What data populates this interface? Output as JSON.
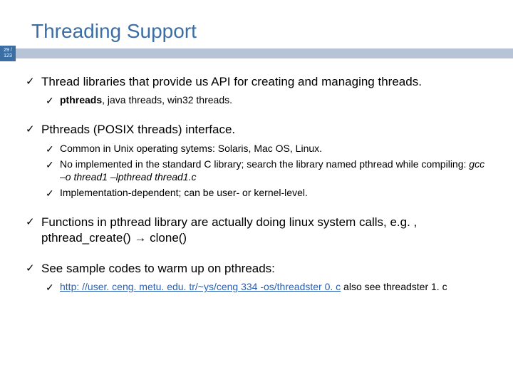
{
  "page": {
    "current": "29",
    "total": "123"
  },
  "title": "Threading Support",
  "b1": {
    "text": "Thread libraries that provide us API for creating and managing threads."
  },
  "b1a_bold": "pthreads",
  "b1a_rest": ", java threads, win32 threads.",
  "b2": {
    "text": "Pthreads (POSIX threads) interface."
  },
  "b2a": "Common in Unix operating sytems: Solaris, Mac OS, Linux.",
  "b2b_pre": "No implemented in the standard C library; search the library named pthread while compiling: ",
  "b2b_italic": "gcc –o thread1 –lpthread thread1.c",
  "b2c": "Implementation-dependent; can be user- or kernel-level.",
  "b3_pre": "Functions in pthread library are actually doing linux system calls, e.g. , pthread_create() ",
  "b3_arrow": "→",
  "b3_post": " clone()",
  "b4": {
    "text": "See sample codes to warm up on pthreads:"
  },
  "b4a_link": "http: //user. ceng. metu. edu. tr/~ys/ceng 334 -os/threadster 0. c",
  "b4a_post": " also see threadster 1. c"
}
